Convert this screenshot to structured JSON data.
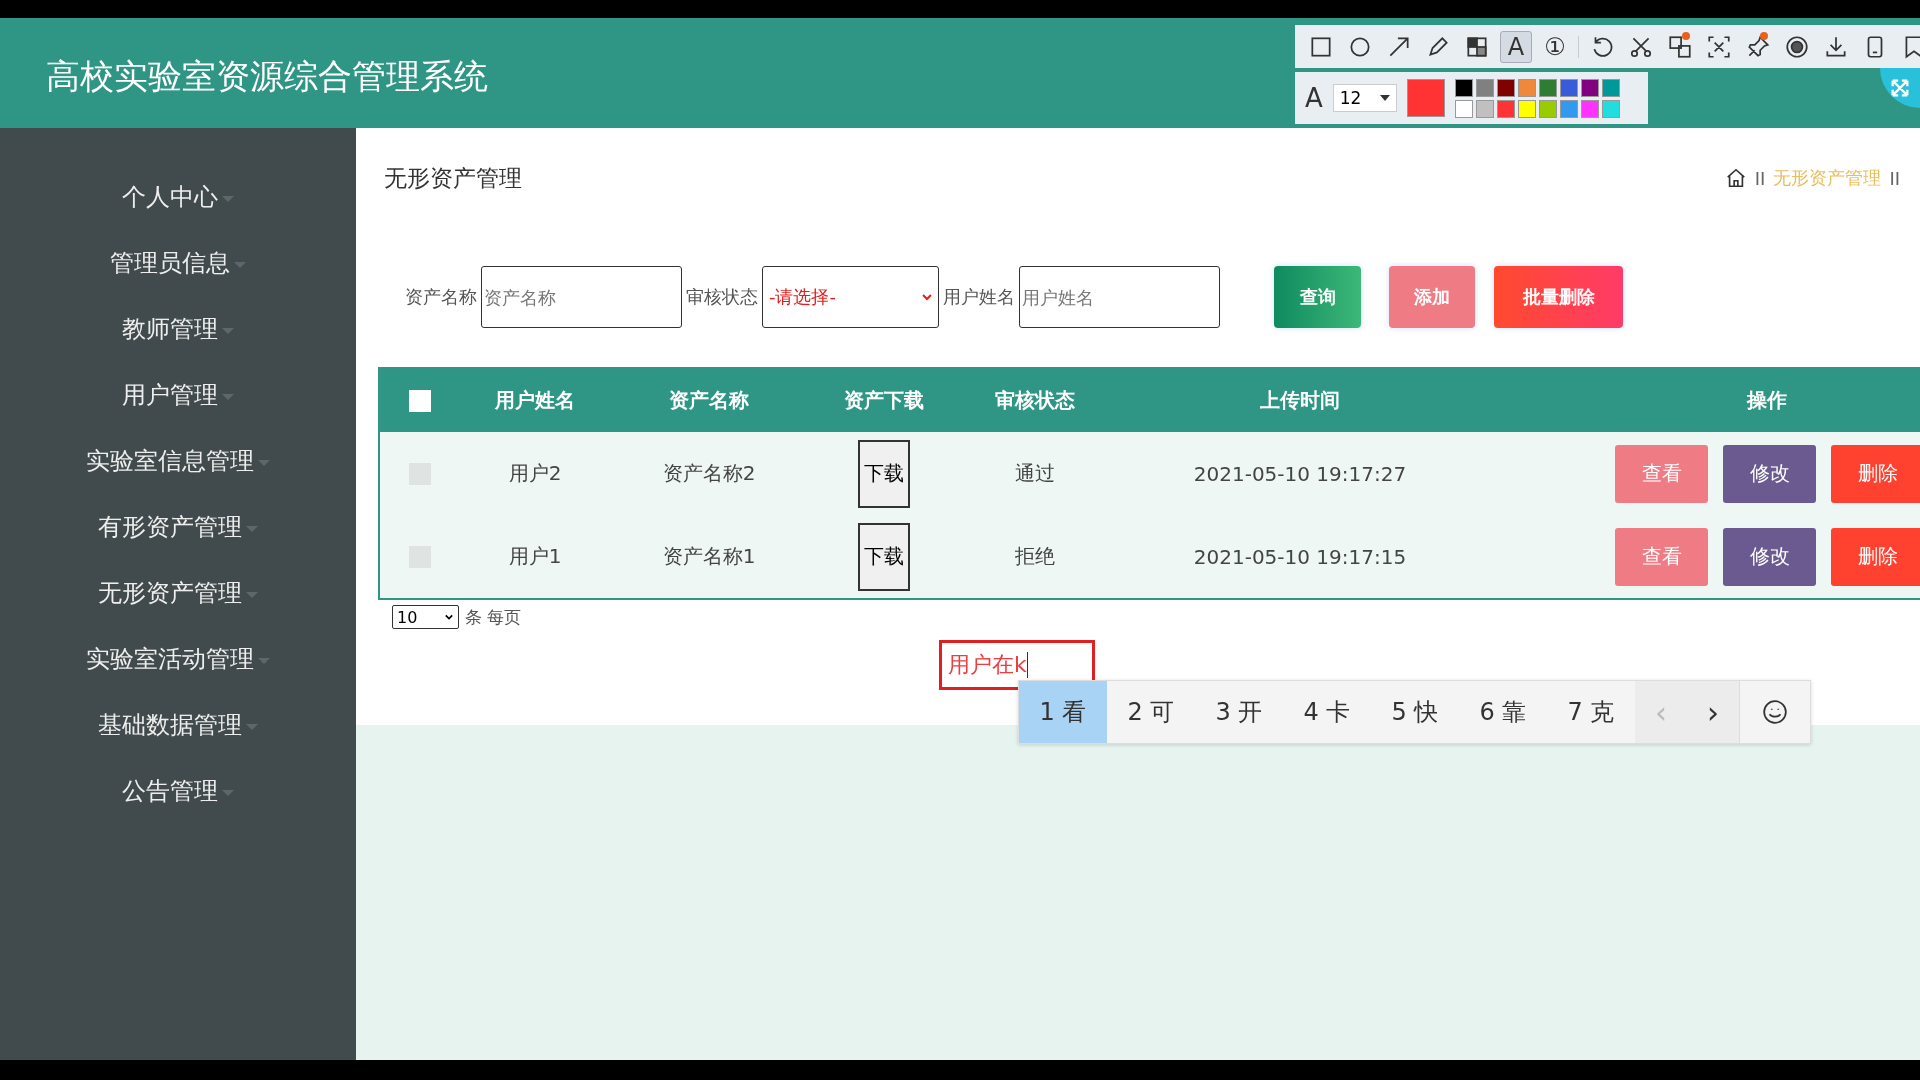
{
  "header": {
    "title": "高校实验室资源综合管理系统"
  },
  "capture_toolbar": {
    "tools": [
      {
        "kind": "rectangle",
        "selected": false,
        "dot": false
      },
      {
        "kind": "ellipse",
        "selected": false,
        "dot": false
      },
      {
        "kind": "arrow",
        "selected": false,
        "dot": false
      },
      {
        "kind": "pencil",
        "selected": false,
        "dot": false
      },
      {
        "kind": "mosaic",
        "selected": false,
        "dot": false
      },
      {
        "kind": "text",
        "glyph": "A",
        "selected": true,
        "dot": false
      },
      {
        "kind": "number",
        "glyph": "①",
        "selected": false,
        "dot": false
      },
      {
        "kind": "undo",
        "selected": false,
        "dot": false
      },
      {
        "kind": "cut",
        "selected": false,
        "dot": false
      },
      {
        "kind": "translate",
        "selected": false,
        "dot": true
      },
      {
        "kind": "ocr",
        "selected": false,
        "dot": false
      },
      {
        "kind": "pin",
        "selected": false,
        "dot": true
      },
      {
        "kind": "record",
        "selected": false,
        "dot": false
      },
      {
        "kind": "download",
        "selected": false,
        "dot": false
      },
      {
        "kind": "phone",
        "selected": false,
        "dot": false
      },
      {
        "kind": "bookmark",
        "selected": false,
        "dot": false
      }
    ],
    "font_glyph": "A",
    "font_size": "12",
    "current_swatch": {
      "color": "#ff3333"
    },
    "palette": [
      {
        "color": "#000000"
      },
      {
        "color": "#808080"
      },
      {
        "color": "#800000"
      },
      {
        "color": "#f0883a"
      },
      {
        "color": "#2e7d32"
      },
      {
        "color": "#3a5bd9"
      },
      {
        "color": "#800080"
      },
      {
        "color": "#009999"
      },
      {
        "color": "#ffffff"
      },
      {
        "color": "#c0c0c0"
      },
      {
        "color": "#ff3333"
      },
      {
        "color": "#ffff00"
      },
      {
        "color": "#99cc00"
      },
      {
        "color": "#3399ee"
      },
      {
        "color": "#ff33ff"
      },
      {
        "color": "#22dddd"
      }
    ]
  },
  "sidebar": {
    "items": [
      {
        "label": "个人中心"
      },
      {
        "label": "管理员信息"
      },
      {
        "label": "教师管理"
      },
      {
        "label": "用户管理"
      },
      {
        "label": "实验室信息管理"
      },
      {
        "label": "有形资产管理"
      },
      {
        "label": "无形资产管理"
      },
      {
        "label": "实验室活动管理"
      },
      {
        "label": "基础数据管理"
      },
      {
        "label": "公告管理"
      }
    ]
  },
  "page_title": "无形资产管理",
  "breadcrumb": [
    {
      "kind": "separator",
      "text": "II"
    },
    {
      "kind": "link",
      "text": "无形资产管理"
    },
    {
      "kind": "separator",
      "text": "II"
    }
  ],
  "search": {
    "fields": [
      {
        "kind": "input",
        "label": "资产名称",
        "placeholder": "资产名称"
      },
      {
        "kind": "select",
        "label": "审核状态",
        "value": "-请选择-"
      },
      {
        "kind": "input",
        "label": "用户姓名",
        "placeholder": "用户姓名"
      }
    ],
    "buttons": [
      {
        "kind": "query",
        "label": "查询"
      },
      {
        "kind": "add",
        "label": "添加"
      },
      {
        "kind": "batch_delete",
        "label": "批量删除"
      }
    ]
  },
  "table": {
    "select_all_checked": false,
    "columns": [
      "用户姓名",
      "资产名称",
      "资产下载",
      "审核状态",
      "上传时间",
      "操作"
    ],
    "rows": [
      {
        "checked": false,
        "user": "用户2",
        "asset": "资产名称2",
        "download": "下载",
        "status": "通过",
        "time": "2021-05-10 19:17:27",
        "actions": [
          {
            "kind": "view",
            "label": "查看"
          },
          {
            "kind": "edit",
            "label": "修改"
          },
          {
            "kind": "delete",
            "label": "删除"
          }
        ]
      },
      {
        "checked": false,
        "user": "用户1",
        "asset": "资产名称1",
        "download": "下载",
        "status": "拒绝",
        "time": "2021-05-10 19:17:15",
        "actions": [
          {
            "kind": "view",
            "label": "查看"
          },
          {
            "kind": "edit",
            "label": "修改"
          },
          {
            "kind": "delete",
            "label": "删除"
          }
        ]
      }
    ]
  },
  "pagination": {
    "page_size": "10",
    "page_size_label": "条 每页"
  },
  "ime": {
    "composition": "用户在k",
    "candidates": [
      {
        "index": "1",
        "text": "看",
        "selected": true
      },
      {
        "index": "2",
        "text": "可",
        "selected": false
      },
      {
        "index": "3",
        "text": "开",
        "selected": false
      },
      {
        "index": "4",
        "text": "卡",
        "selected": false
      },
      {
        "index": "5",
        "text": "快",
        "selected": false
      },
      {
        "index": "6",
        "text": "靠",
        "selected": false
      },
      {
        "index": "7",
        "text": "克",
        "selected": false
      }
    ],
    "prev": "‹",
    "prev_disabled": true,
    "next": "›",
    "next_disabled": false
  }
}
